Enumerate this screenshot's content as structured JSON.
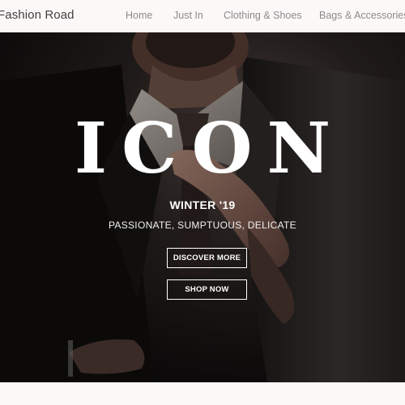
{
  "nav": {
    "brand": "Fashion Road",
    "links": [
      {
        "label": "Home"
      },
      {
        "label": "Just In"
      },
      {
        "label": "Clothing & Shoes"
      },
      {
        "label": "Bags & Accessories"
      }
    ]
  },
  "hero": {
    "title": "ICON",
    "subtitle": "WINTER '19",
    "tagline": "PASSIONATE, SUMPTUOUS, DELICATE",
    "buttons": {
      "discover": "DISCOVER MORE",
      "shop": "SHOP NOW"
    },
    "image": "man-in-suit-adjusting-collar-photo"
  },
  "colors": {
    "nav_background": "#fdf8f8",
    "brand_text": "#3f3f3f",
    "nav_link_text": "#8a8a8a",
    "hero_text": "#ffffff"
  }
}
